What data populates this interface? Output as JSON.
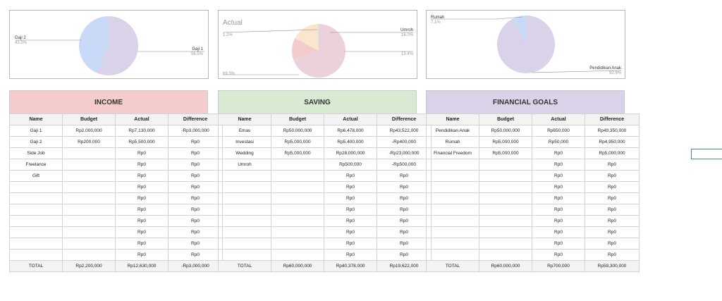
{
  "colors": {
    "income_header": "#f4cccc",
    "saving_header": "#d9ead3",
    "goals_header": "#d9d2e9",
    "pie_lavender": "#d9d2e9",
    "pie_blue": "#c9daf8",
    "pie_pink": "#ead1dc",
    "pie_red": "#f4cccc",
    "pie_peach": "#fce5cd"
  },
  "chart_data": [
    {
      "type": "pie",
      "title": "",
      "slices": [
        {
          "label": "Gaji 1",
          "pct_text": "56.5%",
          "value": 56.5,
          "color": "#d9d2e9"
        },
        {
          "label": "Gaji 2",
          "pct_text": "43.5%",
          "value": 43.5,
          "color": "#c9daf8"
        }
      ]
    },
    {
      "type": "pie",
      "title": "Actual",
      "slices": [
        {
          "label": "",
          "pct_text": "69.3%",
          "value": 69.3,
          "color": "#ead1dc"
        },
        {
          "label": "",
          "pct_text": "13.4%",
          "value": 13.4,
          "color": "#f4cccc"
        },
        {
          "label": "Umroh",
          "pct_text": "16.0%",
          "value": 16.0,
          "color": "#fce5cd"
        },
        {
          "label": "",
          "pct_text": "1.2%",
          "value": 1.2,
          "color": "#d9ead3"
        }
      ]
    },
    {
      "type": "pie",
      "title": "",
      "slices": [
        {
          "label": "Pendidikan Anak",
          "pct_text": "92.9%",
          "value": 92.9,
          "color": "#d9d2e9"
        },
        {
          "label": "Rumah",
          "pct_text": "7.1%",
          "value": 7.1,
          "color": "#c9daf8"
        }
      ]
    }
  ],
  "columns": [
    "Name",
    "Budget",
    "Actual",
    "Difference"
  ],
  "income": {
    "title": "INCOME",
    "rows": [
      [
        "Gaji 1",
        "Rp2,000,000",
        "Rp7,130,000",
        "-Rp3,000,000"
      ],
      [
        "Gaji 2",
        "Rp200,000",
        "Rp5,500,000",
        "Rp0"
      ],
      [
        "Side Job",
        "",
        "Rp0",
        "Rp0"
      ],
      [
        "Freelance",
        "",
        "Rp0",
        "Rp0"
      ],
      [
        "Gift",
        "",
        "Rp0",
        "Rp0"
      ],
      [
        "",
        "",
        "Rp0",
        "Rp0"
      ],
      [
        "",
        "",
        "Rp0",
        "Rp0"
      ],
      [
        "",
        "",
        "Rp0",
        "Rp0"
      ],
      [
        "",
        "",
        "Rp0",
        "Rp0"
      ],
      [
        "",
        "",
        "Rp0",
        "Rp0"
      ],
      [
        "",
        "",
        "Rp0",
        "Rp0"
      ],
      [
        "",
        "",
        "Rp0",
        "Rp0"
      ]
    ],
    "total": [
      "TOTAL",
      "Rp2,200,000",
      "Rp12,630,000",
      "-Rp3,000,000"
    ]
  },
  "saving": {
    "title": "SAVING",
    "rows": [
      [
        "Emas",
        "Rp50,000,000",
        "Rp6,478,000",
        "Rp43,522,000"
      ],
      [
        "Investasi",
        "Rp5,000,000",
        "Rp5,400,000",
        "-Rp400,000"
      ],
      [
        "Wedding",
        "Rp5,000,000",
        "Rp28,000,000",
        "-Rp23,000,000"
      ],
      [
        "Umroh",
        "",
        "Rp500,000",
        "-Rp500,000"
      ],
      [
        "",
        "",
        "Rp0",
        "Rp0"
      ],
      [
        "",
        "",
        "Rp0",
        "Rp0"
      ],
      [
        "",
        "",
        "Rp0",
        "Rp0"
      ],
      [
        "",
        "",
        "Rp0",
        "Rp0"
      ],
      [
        "",
        "",
        "Rp0",
        "Rp0"
      ],
      [
        "",
        "",
        "Rp0",
        "Rp0"
      ],
      [
        "",
        "",
        "Rp0",
        "Rp0"
      ],
      [
        "",
        "",
        "Rp0",
        "Rp0"
      ]
    ],
    "total": [
      "TOTAL",
      "Rp60,000,000",
      "Rp40,378,000",
      "Rp19,622,000"
    ]
  },
  "goals": {
    "title": "FINANCIAL GOALS",
    "rows": [
      [
        "Pendidikan Anak",
        "Rp50,000,000",
        "Rp650,000",
        "Rp49,350,000"
      ],
      [
        "Rumah",
        "Rp5,000,000",
        "Rp50,000",
        "Rp4,950,000"
      ],
      [
        "Financial Freedom",
        "Rp5,000,000",
        "Rp0",
        "Rp5,000,000"
      ],
      [
        "",
        "",
        "Rp0",
        "Rp0"
      ],
      [
        "",
        "",
        "Rp0",
        "Rp0"
      ],
      [
        "",
        "",
        "Rp0",
        "Rp0"
      ],
      [
        "",
        "",
        "Rp0",
        "Rp0"
      ],
      [
        "",
        "",
        "Rp0",
        "Rp0"
      ],
      [
        "",
        "",
        "Rp0",
        "Rp0"
      ],
      [
        "",
        "",
        "Rp0",
        "Rp0"
      ],
      [
        "",
        "",
        "Rp0",
        "Rp0"
      ],
      [
        "",
        "",
        "Rp0",
        "Rp0"
      ]
    ],
    "total": [
      "TOTAL",
      "Rp60,000,000",
      "Rp700,000",
      "Rp59,300,000"
    ]
  }
}
